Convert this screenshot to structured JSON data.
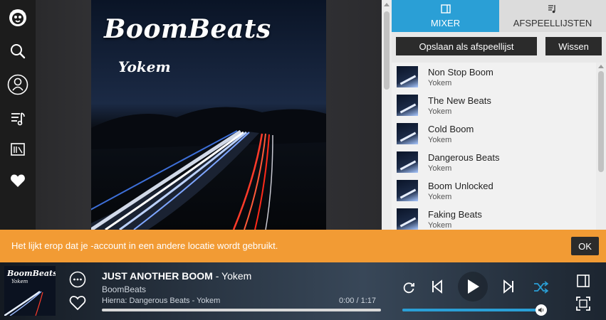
{
  "sidebar": {
    "items": [
      {
        "icon": "napster-logo-icon"
      },
      {
        "icon": "search-icon"
      },
      {
        "icon": "profile-icon"
      },
      {
        "icon": "music-library-icon"
      },
      {
        "icon": "radio-icon"
      },
      {
        "icon": "heart-icon"
      }
    ]
  },
  "album": {
    "title": "BoomBeats",
    "artist": "Yokem"
  },
  "panel": {
    "tabs": [
      {
        "label": "MIXER",
        "icon": "mixer-icon",
        "active": true
      },
      {
        "label": "AFSPEELLIJSTEN",
        "icon": "playlist-icon",
        "active": false
      }
    ],
    "save_label": "Opslaan als afspeellijst",
    "clear_label": "Wissen",
    "tracks": [
      {
        "title": "Non Stop Boom",
        "artist": "Yokem"
      },
      {
        "title": "The New Beats",
        "artist": "Yokem"
      },
      {
        "title": "Cold Boom",
        "artist": "Yokem"
      },
      {
        "title": "Dangerous Beats",
        "artist": "Yokem"
      },
      {
        "title": "Boom Unlocked",
        "artist": "Yokem"
      },
      {
        "title": "Faking Beats",
        "artist": "Yokem"
      }
    ]
  },
  "notice": {
    "text": "Het lijkt erop dat je -account in een andere locatie wordt gebruikt.",
    "ok_label": "OK",
    "color": "#f29b34"
  },
  "player": {
    "track_title": "JUST ANOTHER BOOM",
    "track_artist": " - Yokem",
    "album": "BoomBeats",
    "next": "Hierna: Dangerous Beats - Yokem",
    "time": "0:00 / 1:17",
    "progress": 0.0,
    "volume": 0.99,
    "art_title": "BoomBeats",
    "art_artist": "Yokem"
  },
  "colors": {
    "accent": "#2a9fd6",
    "sidebar": "#1c1c1c",
    "dark_button": "#2b2b2b"
  }
}
